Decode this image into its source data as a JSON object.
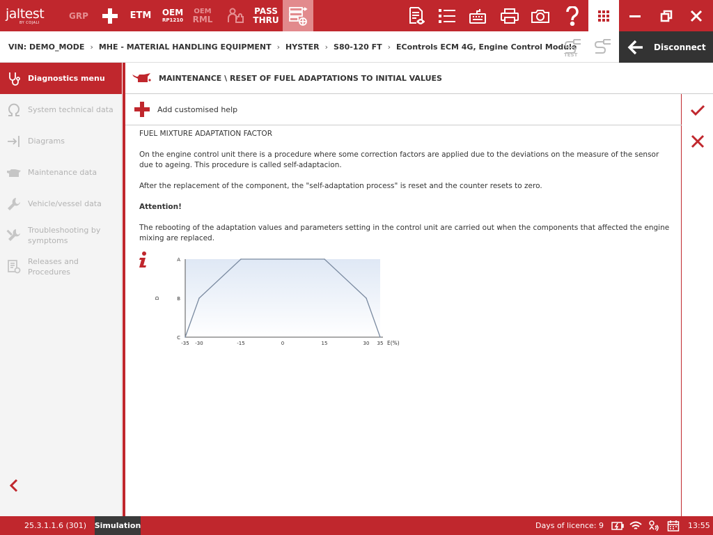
{
  "app": {
    "logo_text": "jaltest",
    "logo_sub": "BY COJALI",
    "grp_label": "GRP",
    "etm_label": "ETM",
    "oem_label": "OEM",
    "oem_sub": "RP1210",
    "oem_rml_top": "OEM",
    "oem_rml_bottom": "RML",
    "pass_thru_top": "PASS",
    "pass_thru_bottom": "THRU"
  },
  "breadcrumb": {
    "vin": "VIN: DEMO_MODE",
    "items": [
      "MHE - MATERIAL HANDLING EQUIPMENT",
      "HYSTER",
      "S80-120 FT",
      "EControls ECM 4G, Engine Control Module"
    ],
    "test_label": "TEST"
  },
  "disconnect": {
    "label": "Disconnect"
  },
  "sidebar": {
    "items": [
      {
        "label": "Diagnostics menu",
        "icon": "stethoscope-icon",
        "active": true
      },
      {
        "label": "System technical data",
        "icon": "omega-icon"
      },
      {
        "label": "Diagrams",
        "icon": "diagram-arrow-icon"
      },
      {
        "label": "Maintenance data",
        "icon": "oil-can-icon"
      },
      {
        "label": "Vehicle/vessel data",
        "icon": "wrench-icon"
      },
      {
        "label": "Troubleshooting by symptoms",
        "icon": "tools-icon"
      },
      {
        "label": "Releases and Procedures",
        "icon": "document-gear-icon"
      }
    ]
  },
  "main": {
    "title": "MAINTENANCE \\ RESET OF FUEL ADAPTATIONS TO INITIAL VALUES",
    "add_help": "Add customised help",
    "doc": {
      "heading": "FUEL MIXTURE ADAPTATION FACTOR",
      "p1": "On the engine control unit there is a procedure where some correction factors are applied due to the deviations on the measure of the sensor due to ageing. This procedure is called self-adaptacion.",
      "p2": "After the replacement of the component, the \"self-adaptation process\" is reset and the counter resets to zero.",
      "attention": "Attention!",
      "p3": "The rebooting of the adaptation values and parameters setting in the control unit are carried out when the components that affected the engine mixing are replaced."
    }
  },
  "chart_data": {
    "type": "line",
    "x": [
      -35,
      -30,
      -15,
      15,
      30,
      35
    ],
    "y_levels": [
      "C",
      "B",
      "A"
    ],
    "values": [
      "C",
      "B",
      "A",
      "A",
      "B",
      "C"
    ],
    "x_ticks": [
      "-35",
      "-30",
      "-15",
      "0",
      "15",
      "30",
      "35"
    ],
    "xlabel": "E(%)",
    "ylabel": "D",
    "fill": "#dfe8f5",
    "line_color": "#7a8aa0"
  },
  "status": {
    "version": "25.3.1.1.6 (301)",
    "mode": "Simulation",
    "licence": "Days of licence: 9",
    "time": "13:55"
  },
  "colors": {
    "brand": "#c0272d",
    "dark": "#333333"
  }
}
